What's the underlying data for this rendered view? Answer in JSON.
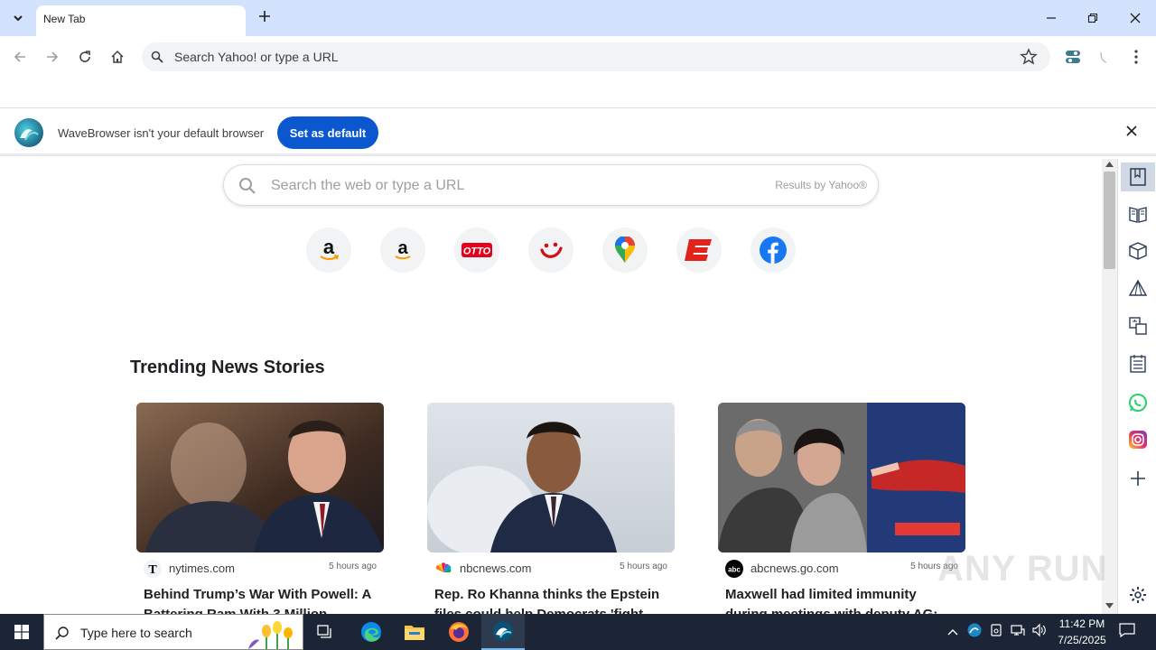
{
  "browser": {
    "tab_title": "New Tab",
    "omnibox_placeholder": "Search Yahoo! or type a URL"
  },
  "infobar": {
    "message": "WaveBrowser isn't your default browser",
    "button_label": "Set as default"
  },
  "newtab": {
    "search_placeholder": "Search the web or type a URL",
    "results_by": "Results by Yahoo®",
    "shortcuts": [
      {
        "name": "amazon",
        "glyph": "a"
      },
      {
        "name": "amazon-2",
        "glyph": "a"
      },
      {
        "name": "otto",
        "glyph": "OTTO"
      },
      {
        "name": "tui",
        "glyph": "ツ"
      },
      {
        "name": "google-maps",
        "glyph": ""
      },
      {
        "name": "espn",
        "glyph": "E"
      },
      {
        "name": "facebook",
        "glyph": "f"
      }
    ],
    "trending_title": "Trending News Stories",
    "cards": [
      {
        "source": "nytimes.com",
        "time": "5 hours ago",
        "title": "Behind Trump’s War With Powell: A Battering Ram With 3 Million",
        "source_icon": "nytimes-icon"
      },
      {
        "source": "nbcnews.com",
        "time": "5 hours ago",
        "title": "Rep. Ro Khanna thinks the Epstein files could help Democrats 'fight",
        "source_icon": "nbc-icon"
      },
      {
        "source": "abcnews.go.com",
        "time": "5 hours ago",
        "title": "Maxwell had limited immunity during meetings with deputy AG:",
        "source_icon": "abc-icon"
      }
    ]
  },
  "taskbar": {
    "search_placeholder": "Type here to search",
    "time": "11:42 PM",
    "date": "7/25/2025"
  },
  "watermark": "ANY RUN"
}
